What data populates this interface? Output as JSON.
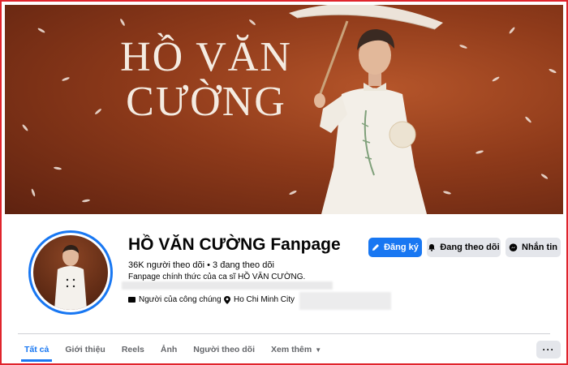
{
  "cover": {
    "title_line1": "HỒ VĂN",
    "title_line2": "CƯỜNG"
  },
  "profile": {
    "name": "HỒ VĂN CƯỜNG Fanpage",
    "followers": "36K người theo dõi • 3 đang theo dõi",
    "bio": "Fanpage chính thức của ca sĩ HỒ VĂN CƯỜNG.",
    "category": "Người của công chúng",
    "location": "Ho Chi Minh City"
  },
  "actions": {
    "register": "Đăng ký",
    "following": "Đang theo dõi",
    "message": "Nhắn tin"
  },
  "tabs": [
    {
      "label": "Tất cả"
    },
    {
      "label": "Giới thiệu"
    },
    {
      "label": "Reels"
    },
    {
      "label": "Ảnh"
    },
    {
      "label": "Người theo dõi"
    },
    {
      "label": "Xem thêm"
    }
  ],
  "more_options": "···",
  "colors": {
    "accent": "#1877f2",
    "frame": "#e0242c",
    "cover_bg": "#8e3a1a"
  }
}
